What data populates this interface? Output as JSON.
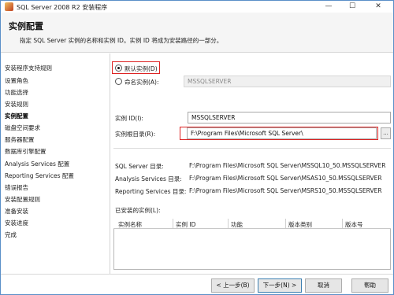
{
  "window": {
    "title": "SQL Server 2008 R2 安装程序",
    "minimize": "—",
    "maximize": "☐",
    "close": "✕"
  },
  "header": {
    "title": "实例配置",
    "description": "指定 SQL Server 实例的名称和实例 ID。实例 ID 将成为安装路径的一部分。"
  },
  "nav": {
    "items": [
      {
        "label": "安装程序支持规则"
      },
      {
        "label": "设置角色"
      },
      {
        "label": "功能选择"
      },
      {
        "label": "安装规则"
      },
      {
        "label": "实例配置"
      },
      {
        "label": "磁盘空间要求"
      },
      {
        "label": "服务器配置"
      },
      {
        "label": "数据库引擎配置"
      },
      {
        "label": "Analysis Services 配置"
      },
      {
        "label": "Reporting Services 配置"
      },
      {
        "label": "错误报告"
      },
      {
        "label": "安装配置规则"
      },
      {
        "label": "准备安装"
      },
      {
        "label": "安装进度"
      },
      {
        "label": "完成"
      }
    ]
  },
  "instance": {
    "default_label": "默认实例(D)",
    "named_label": "命名实例(A):",
    "named_value": "MSSQLSERVER",
    "id_label": "实例 ID(I):",
    "id_value": "MSSQLSERVER",
    "root_label": "实例根目录(R):",
    "root_value": "F:\\Program Files\\Microsoft SQL Server\\",
    "browse_label": "..."
  },
  "directories": [
    {
      "label": "SQL Server 目录:",
      "value": "F:\\Program Files\\Microsoft SQL Server\\MSSQL10_50.MSSQLSERVER"
    },
    {
      "label": "Analysis Services 目录:",
      "value": "F:\\Program Files\\Microsoft SQL Server\\MSAS10_50.MSSQLSERVER"
    },
    {
      "label": "Reporting Services 目录:",
      "value": "F:\\Program Files\\Microsoft SQL Server\\MSRS10_50.MSSQLSERVER"
    }
  ],
  "installed": {
    "label": "已安装的实例(L):",
    "columns": [
      "实例名称",
      "实例 ID",
      "功能",
      "版本类别",
      "版本号"
    ]
  },
  "footer": {
    "back": "< 上一步(B)",
    "next": "下一步(N) >",
    "cancel": "取消",
    "help": "帮助"
  }
}
